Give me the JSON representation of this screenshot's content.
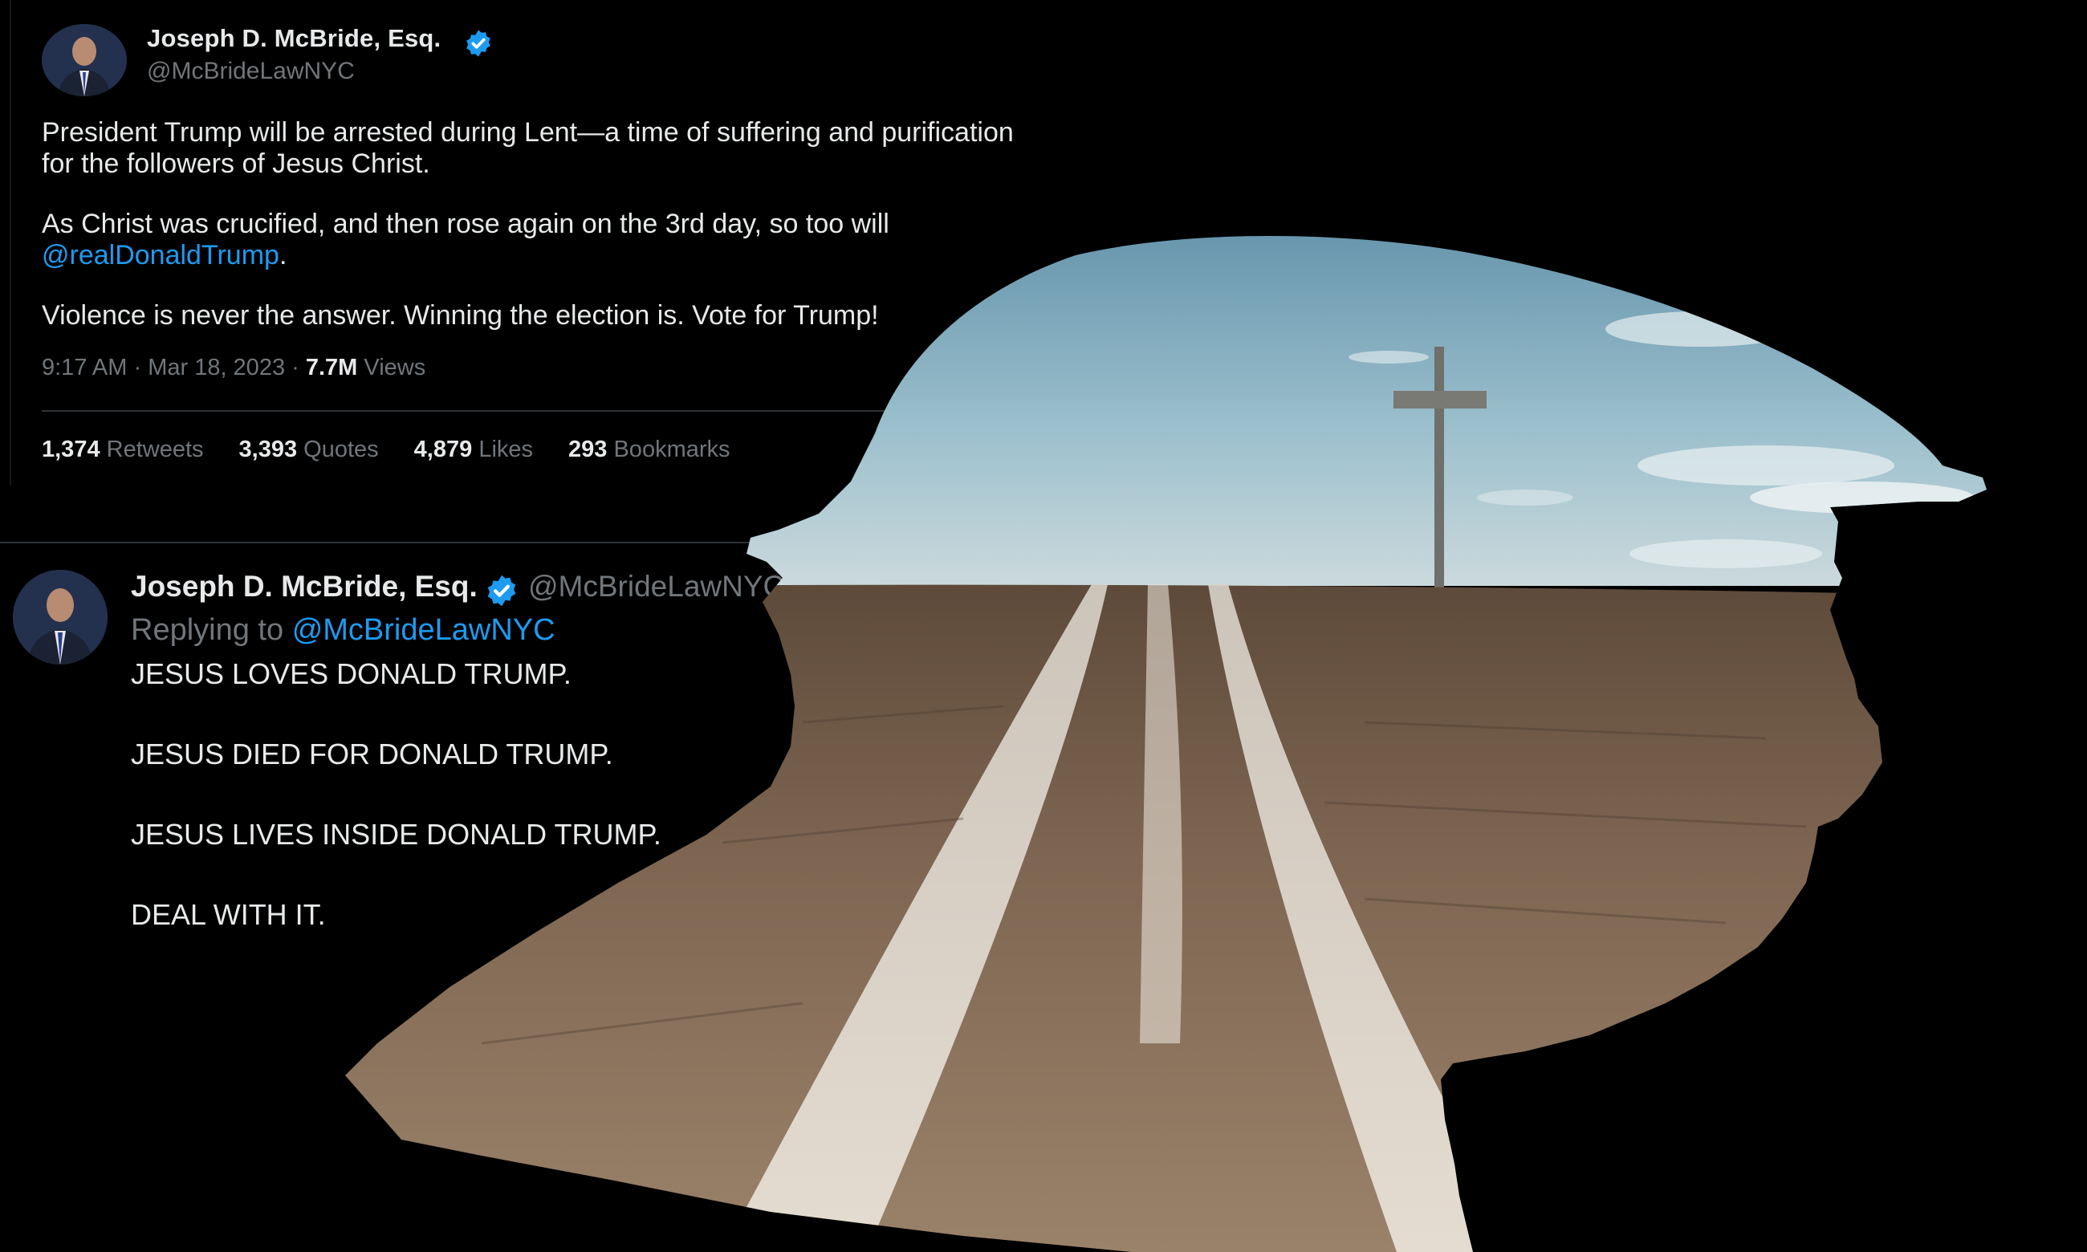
{
  "tweet1": {
    "author_name": "Joseph D. McBride, Esq.",
    "author_handle": "@McBrideLawNYC",
    "paragraph1": "President Trump will be arrested during Lent—a time of suffering and purification for the followers of Jesus Christ.",
    "paragraph2_text": "As Christ was crucified, and then rose again on the 3rd day, so too will",
    "paragraph2_mention": "@realDonaldTrump",
    "paragraph2_end": ".",
    "paragraph3": "Violence is never the answer. Winning the election is. Vote for Trump!",
    "time": "9:17 AM",
    "date": "Mar 18, 2023",
    "views_count": "7.7M",
    "views_label": "Views",
    "stats": [
      {
        "count": "1,374",
        "label": "Retweets"
      },
      {
        "count": "3,393",
        "label": "Quotes"
      },
      {
        "count": "4,879",
        "label": "Likes"
      },
      {
        "count": "293",
        "label": "Bookmarks"
      }
    ]
  },
  "tweet2": {
    "author_name": "Joseph D. McBride, Esq.",
    "author_handle": "@McBrideLawNYC · M",
    "reply_prefix": "Replying to",
    "reply_mention": "@McBrideLawNYC",
    "lines": [
      "JESUS LOVES DONALD TRUMP.",
      "JESUS DIED FOR DONALD TRUMP.",
      "JESUS LIVES INSIDE DONALD TRUMP.",
      "DEAL WITH IT."
    ]
  },
  "colors": {
    "background": "#000000",
    "text_primary": "#e7e9ea",
    "text_secondary": "#71767b",
    "link": "#1d9bf0",
    "verified": "#1d9bf0",
    "sky": "#86aebf",
    "field": "#7a6552"
  },
  "icons": {
    "verified": "verified-badge-icon",
    "avatar": "avatar"
  }
}
